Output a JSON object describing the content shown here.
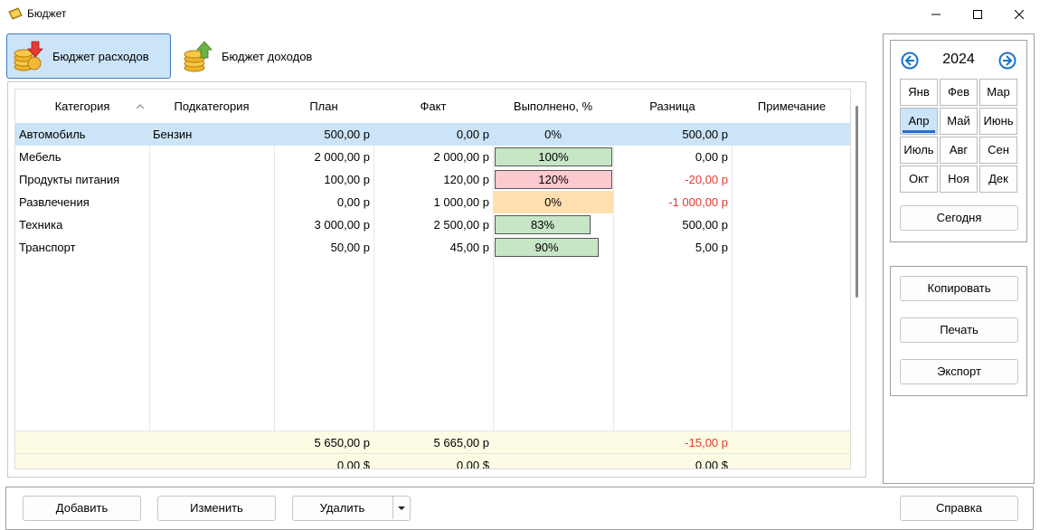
{
  "window": {
    "title": "Бюджет"
  },
  "tabs": [
    {
      "label": "Бюджет расходов"
    },
    {
      "label": "Бюджет доходов"
    }
  ],
  "table": {
    "columns": [
      "Категория",
      "Подкатегория",
      "План",
      "Факт",
      "Выполнено, %",
      "Разница",
      "Примечание"
    ],
    "rows": [
      {
        "category": "Автомобиль",
        "subcategory": "Бензин",
        "plan": "500,00 р",
        "fact": "0,00 р",
        "percent": "0%",
        "diff": "500,00 р",
        "note": ""
      },
      {
        "category": "Мебель",
        "subcategory": "",
        "plan": "2 000,00 р",
        "fact": "2 000,00 р",
        "percent": "100%",
        "diff": "0,00 р",
        "note": ""
      },
      {
        "category": "Продукты питания",
        "subcategory": "",
        "plan": "100,00 р",
        "fact": "120,00 р",
        "percent": "120%",
        "diff": "-20,00 р",
        "note": ""
      },
      {
        "category": "Развлечения",
        "subcategory": "",
        "plan": "0,00 р",
        "fact": "1 000,00 р",
        "percent": "0%",
        "diff": "-1 000,00 р",
        "note": ""
      },
      {
        "category": "Техника",
        "subcategory": "",
        "plan": "3 000,00 р",
        "fact": "2 500,00 р",
        "percent": "83%",
        "diff": "500,00 р",
        "note": ""
      },
      {
        "category": "Транспорт",
        "subcategory": "",
        "plan": "50,00 р",
        "fact": "45,00 р",
        "percent": "90%",
        "diff": "5,00 р",
        "note": ""
      }
    ],
    "totals": [
      {
        "plan": "5 650,00 р",
        "fact": "5 665,00 р",
        "diff": "-15,00 р"
      },
      {
        "plan": "0,00 $",
        "fact": "0,00 $",
        "diff": "0,00 $"
      }
    ]
  },
  "calendar": {
    "year": "2024",
    "months": [
      "Янв",
      "Фев",
      "Мар",
      "Апр",
      "Май",
      "Июнь",
      "Июль",
      "Авг",
      "Сен",
      "Окт",
      "Ноя",
      "Дек"
    ],
    "selected_month": "Апр",
    "today_button": "Сегодня"
  },
  "actions": {
    "copy": "Копировать",
    "print": "Печать",
    "export": "Экспорт"
  },
  "bottom": {
    "add": "Добавить",
    "edit": "Изменить",
    "delete": "Удалить",
    "help": "Справка"
  },
  "colors": {
    "selection": "#cce4f7",
    "accent": "#2a6bd1",
    "bar_green": "#c6e6c6",
    "bar_red": "#fcc9cf",
    "bar_orange": "#ffdfb0",
    "negative": "#e03c31",
    "totals_bg": "#fdfbe4"
  }
}
